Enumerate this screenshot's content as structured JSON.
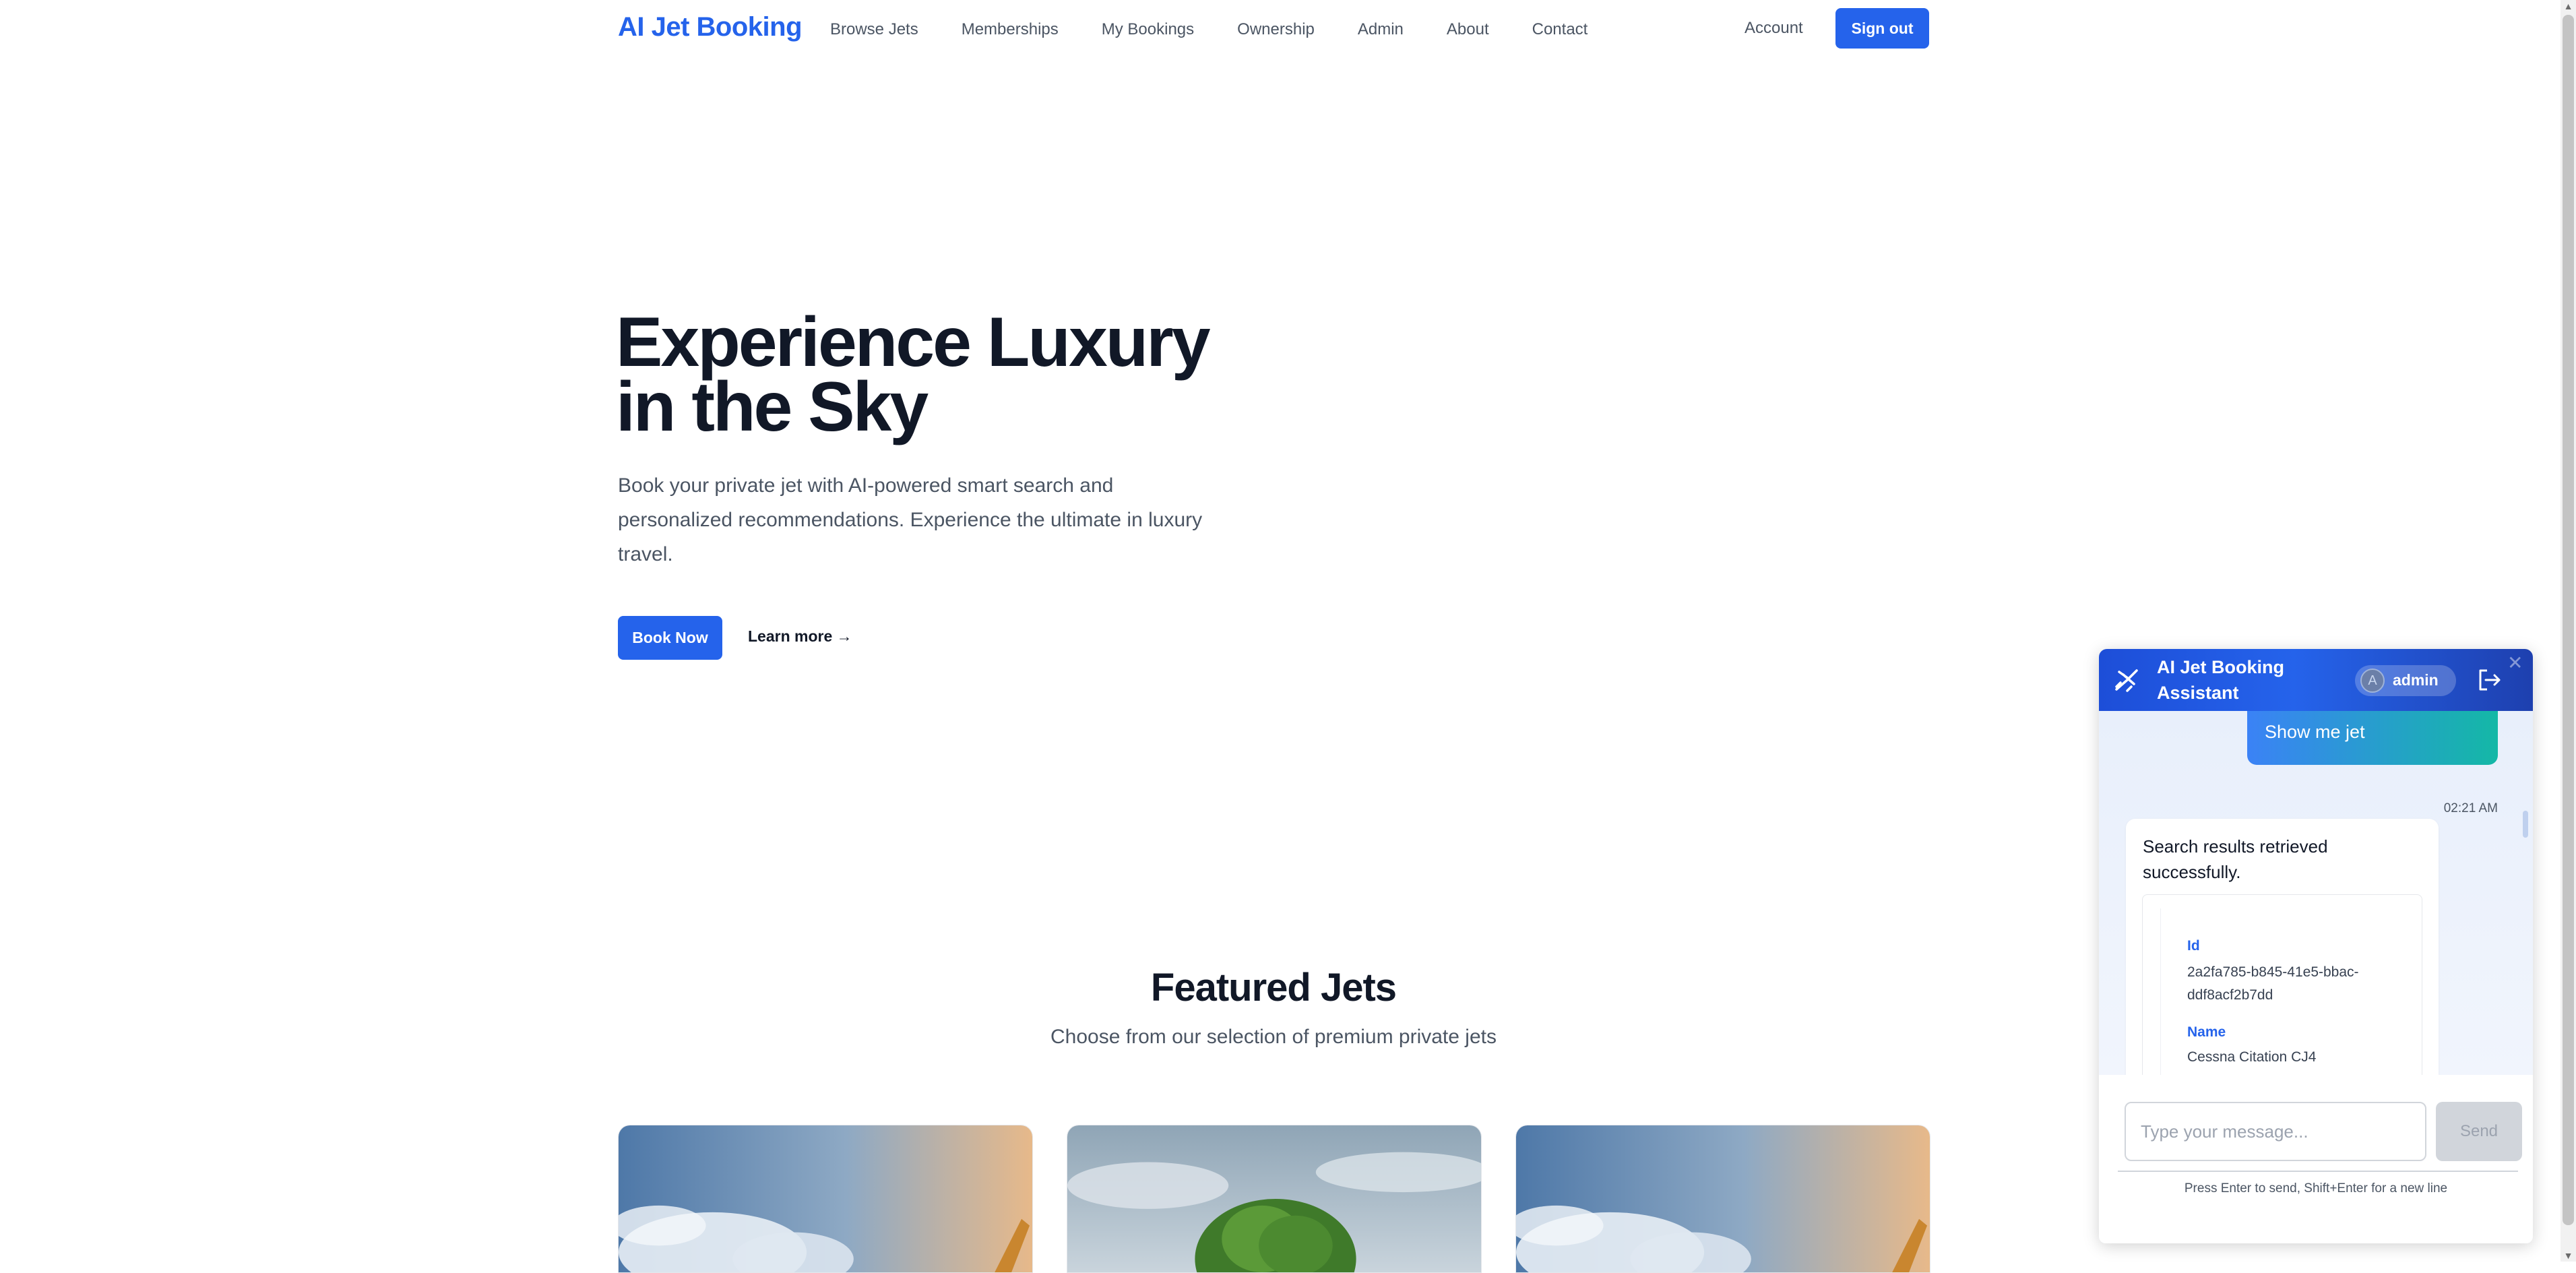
{
  "nav": {
    "logo": "AI Jet Booking",
    "links": [
      "Browse Jets",
      "Memberships",
      "My Bookings",
      "Ownership",
      "Admin",
      "About",
      "Contact"
    ],
    "account": "Account",
    "sign_out": "Sign out"
  },
  "hero": {
    "title_line1": "Experience Luxury",
    "title_line2": "in the Sky",
    "subtitle": "Book your private jet with AI-powered smart search and personalized recommendations. Experience the ultimate in luxury travel.",
    "book_now": "Book Now",
    "learn_more": "Learn more →"
  },
  "featured": {
    "title": "Featured Jets",
    "subtitle": "Choose from our selection of premium private jets"
  },
  "chat": {
    "title": "AI Jet Booking Assistant",
    "user_initial": "A",
    "user_name": "admin",
    "user_message": "Show me jet",
    "message_time": "02:21 AM",
    "bot_message": "Search results retrieved successfully.",
    "result": {
      "id_label": "Id",
      "id_value": "2a2fa785-b845-41e5-bbac-ddf8acf2b7dd",
      "name_label": "Name",
      "name_value": "Cessna Citation CJ4"
    },
    "input_placeholder": "Type your message...",
    "send": "Send",
    "hint": "Press Enter to send, Shift+Enter for a new line"
  },
  "colors": {
    "accent": "#2563eb",
    "header_gradient_start": "#1d4ed8",
    "user_bubble_start": "#3b82f6",
    "user_bubble_end": "#14b8a6"
  },
  "icons": {
    "plane": "plane-icon",
    "logout": "logout-icon",
    "close": "close-icon"
  }
}
